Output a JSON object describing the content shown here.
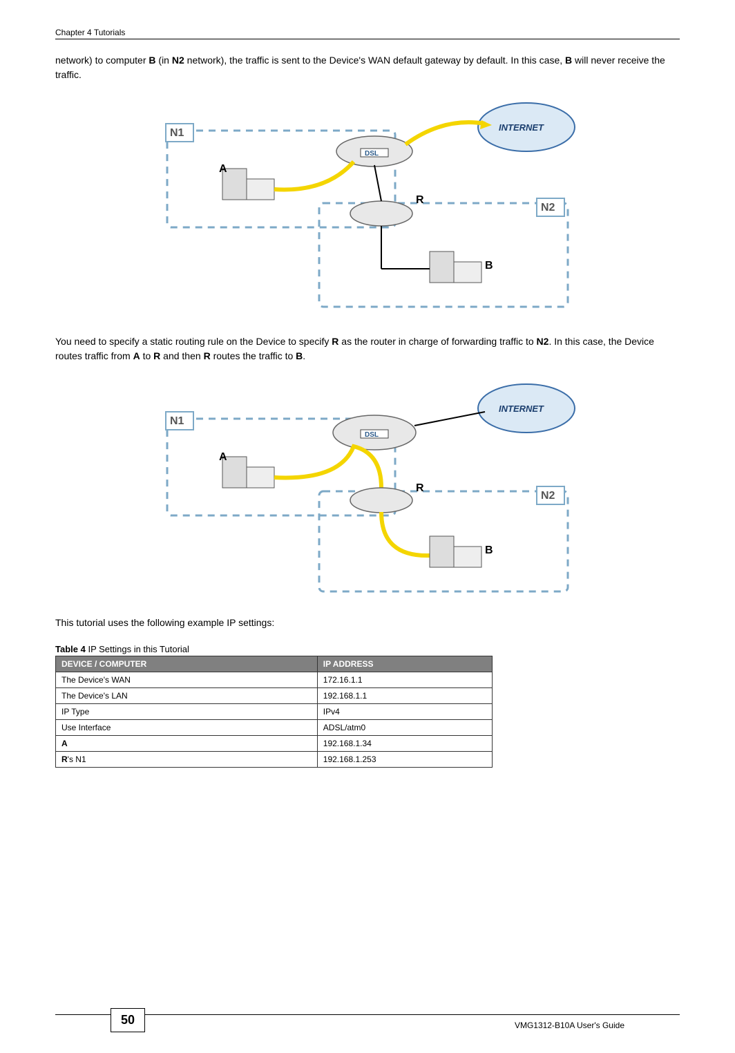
{
  "header": {
    "left": "Chapter 4 Tutorials"
  },
  "para1_parts": [
    "network) to computer ",
    "B",
    " (in ",
    "N2",
    " network), the traffic is sent to the Device's WAN default gateway by default. In this case, ",
    "B",
    " will never receive the traffic."
  ],
  "diagram1": {
    "n1": "N1",
    "n2": "N2",
    "a": "A",
    "b": "B",
    "r": "R",
    "internet": "INTERNET",
    "dsl": "DSL"
  },
  "para2_parts": [
    "You need to specify a static routing rule on the Device to specify ",
    "R",
    " as the router in charge of forwarding traffic to ",
    "N2",
    ". In this case, the Device routes traffic from ",
    "A",
    " to ",
    "R",
    " and then ",
    "R",
    " routes the traffic to ",
    "B",
    "."
  ],
  "diagram2": {
    "n1": "N1",
    "n2": "N2",
    "a": "A",
    "b": "B",
    "r": "R",
    "internet": "INTERNET",
    "dsl": "DSL"
  },
  "para3": "This tutorial uses the following example IP settings:",
  "table": {
    "caption_prefix": "Table 4",
    "caption_rest": "   IP Settings in this Tutorial",
    "headers": [
      "DEVICE / COMPUTER",
      "IP ADDRESS"
    ],
    "rows": [
      [
        "The Device's WAN",
        "172.16.1.1"
      ],
      [
        "The Device's LAN",
        "192.168.1.1"
      ],
      [
        "IP Type",
        "IPv4"
      ],
      [
        "Use Interface",
        "ADSL/atm0"
      ],
      [
        "A",
        "192.168.1.34",
        true
      ],
      [
        "R's N1",
        "192.168.1.253",
        true
      ]
    ]
  },
  "footer": {
    "page": "50",
    "guide": "VMG1312-B10A User's Guide"
  }
}
